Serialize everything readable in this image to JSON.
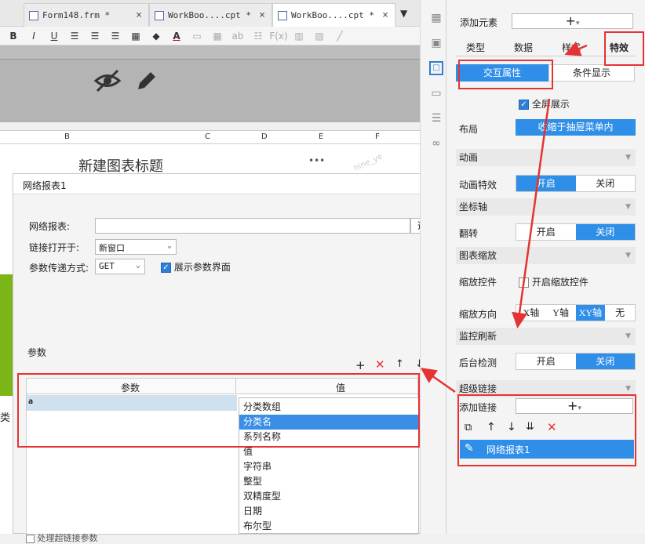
{
  "tabs": [
    {
      "label": "Form148.frm *",
      "active": false
    },
    {
      "label": "WorkBoo....cpt *",
      "active": false
    },
    {
      "label": "WorkBoo....cpt *",
      "active": true
    }
  ],
  "toolbar": {
    "bold": "B",
    "italic": "I",
    "underline": "U",
    "text_color": "A",
    "ab": "ab",
    "fx": "F(x)"
  },
  "sheet": {
    "columns": [
      "B",
      "C",
      "D",
      "E",
      "F"
    ],
    "chart_title": "新建图表标题",
    "dots": "•••",
    "side_char": "类",
    "watermark": "hine_ye"
  },
  "dialog": {
    "title": "网络报表1",
    "field_report_label": "网络报表:",
    "select_button": "选择",
    "open_label": "链接打开于:",
    "open_value": "新窗口",
    "method_label": "参数传递方式:",
    "method_value": "GET",
    "show_params_label": "展示参数界面",
    "params_section": "参数",
    "table_headers": [
      "参数",
      "值"
    ],
    "table_rows": [
      {
        "param": "a",
        "value": ""
      }
    ],
    "bottom_hint": "处理超链接参数"
  },
  "dropdown": {
    "items": [
      "分类数组",
      "分类名",
      "系列名称",
      "值",
      "字符串",
      "整型",
      "双精度型",
      "日期",
      "布尔型"
    ],
    "selected_index": 1
  },
  "panel": {
    "add_element_label": "添加元素",
    "add_symbol": "+",
    "tabs": [
      "类型",
      "数据",
      "样式",
      "特效"
    ],
    "subtabs": [
      "交互属性",
      "条件显示"
    ],
    "fullscreen_label": "全屏展示",
    "layout_label": "布局",
    "layout_value": "收缩于抽屉菜单内",
    "animation_section": "动画",
    "animation_effect_label": "动画特效",
    "animation_options": [
      "开启",
      "关闭"
    ],
    "axis_section": "坐标轴",
    "flip_label": "翻转",
    "flip_options": [
      "开启",
      "关闭"
    ],
    "zoom_section": "图表缩放",
    "zoom_control_label": "缩放控件",
    "zoom_control_checkbox": "开启缩放控件",
    "zoom_dir_label": "缩放方向",
    "zoom_dir_options": [
      "X轴",
      "Y轴",
      "XY轴",
      "无"
    ],
    "monitor_section": "监控刷新",
    "bg_check_label": "后台检测",
    "bg_check_options": [
      "开启",
      "关闭"
    ],
    "hyperlink_section": "超级链接",
    "add_link_label": "添加链接",
    "link_item": "网络报表1"
  },
  "colors": {
    "accent": "#2f8fe8",
    "highlight_red": "#e53333",
    "green": "#7cb518"
  }
}
